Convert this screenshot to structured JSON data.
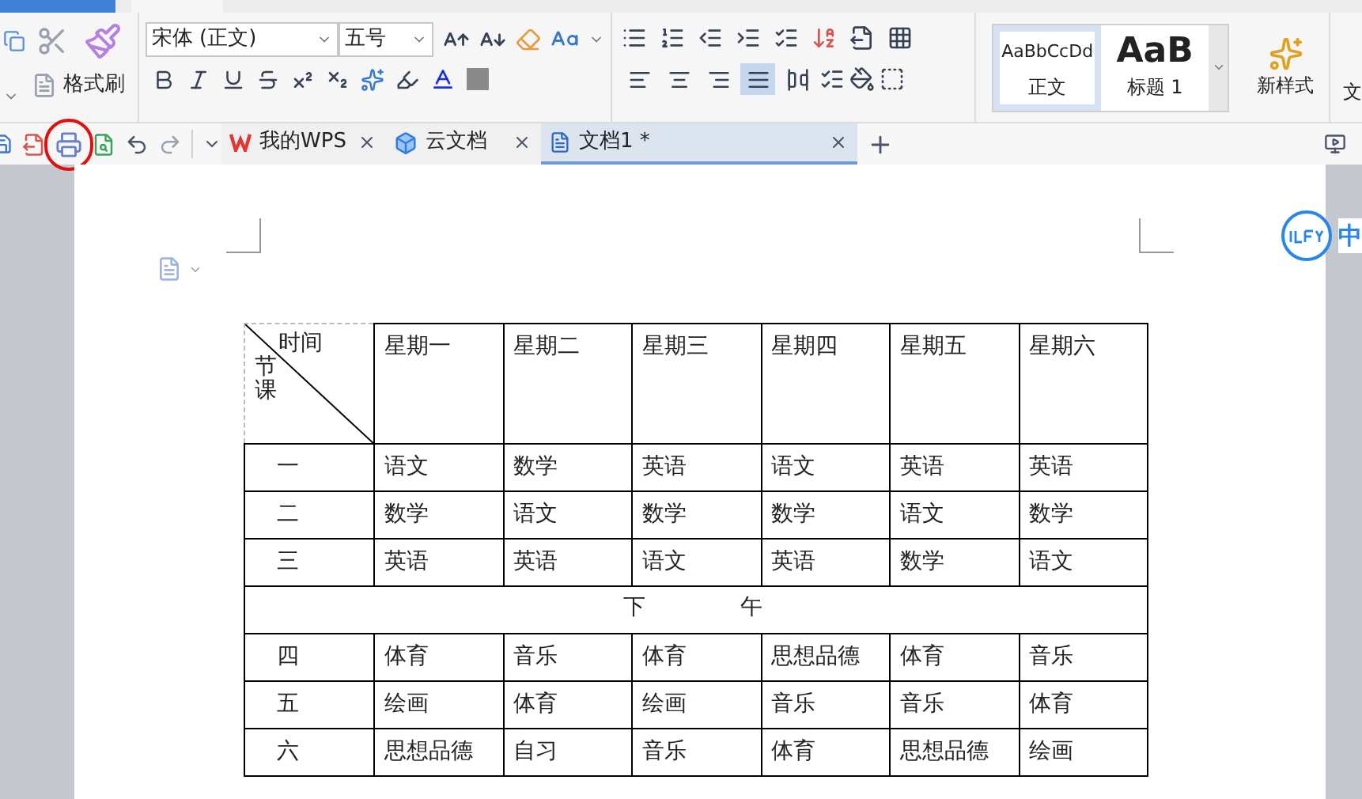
{
  "ribbon": {
    "format_painter": "格式刷",
    "font_name": "宋体 (正文)",
    "font_size": "五号",
    "alignment": [
      {
        "selected": false
      },
      {
        "selected": false
      },
      {
        "selected": false
      },
      {
        "selected": true
      },
      {
        "selected": false
      }
    ],
    "styles": [
      {
        "kind": "body",
        "preview": "AaBbCcDd",
        "label": "正文",
        "selected": true
      },
      {
        "kind": "heading",
        "preview": "AaB",
        "label": "标题 1",
        "selected": false
      }
    ],
    "new_style": "新样式",
    "text_tool": "文"
  },
  "tabs": [
    {
      "kind": "wps",
      "label": "我的WPS",
      "selected": false
    },
    {
      "kind": "cloud",
      "label": "云文档",
      "selected": false
    },
    {
      "kind": "doc",
      "label": "文档1 *",
      "selected": true
    }
  ],
  "ifly": {
    "label": "中"
  },
  "table": {
    "corner": {
      "top": "时间",
      "side": "节课"
    },
    "days": [
      "星期一",
      "星期二",
      "星期三",
      "星期四",
      "星期五",
      "星期六"
    ],
    "rows": [
      {
        "kind": "lesson",
        "period": "一",
        "cells": [
          "语文",
          "数学",
          "英语",
          "语文",
          "英语",
          "英语"
        ]
      },
      {
        "kind": "lesson",
        "period": "二",
        "cells": [
          "数学",
          "语文",
          "数学",
          "数学",
          "语文",
          "数学"
        ]
      },
      {
        "kind": "lesson",
        "period": "三",
        "cells": [
          "英语",
          "英语",
          "语文",
          "英语",
          "数学",
          "语文"
        ]
      },
      {
        "kind": "break",
        "parts": [
          "下",
          "午"
        ]
      },
      {
        "kind": "lesson",
        "period": "四",
        "cells": [
          "体育",
          "音乐",
          "体育",
          "思想品德",
          "体育",
          "音乐"
        ]
      },
      {
        "kind": "lesson",
        "period": "五",
        "cells": [
          "绘画",
          "体育",
          "绘画",
          "音乐",
          "音乐",
          "体育"
        ]
      },
      {
        "kind": "lesson",
        "period": "六",
        "cells": [
          "思想品德",
          "自习",
          "音乐",
          "体育",
          "思想品德",
          "绘画"
        ]
      }
    ]
  }
}
